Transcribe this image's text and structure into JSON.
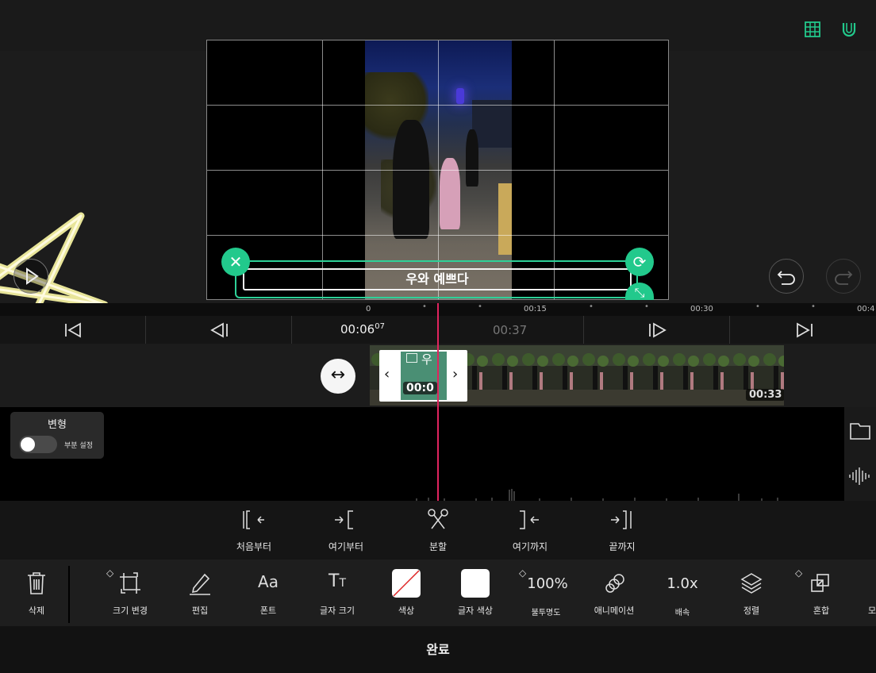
{
  "preview": {
    "subtitle": "우와 예쁘다"
  },
  "ruler": {
    "ticks": [
      "0",
      "00:15",
      "00:30",
      "00:4"
    ]
  },
  "transport": {
    "current_time": "00:06",
    "current_frames": "07",
    "total_time": "00:37"
  },
  "timeline": {
    "text_clip_glyph": "우",
    "text_clip_time": "00:0",
    "video_clip_duration": "00:33"
  },
  "transform_panel": {
    "title": "변형",
    "toggle_label": "부분 설정",
    "toggle_on": false
  },
  "edit_actions": [
    {
      "label": "처음부터",
      "icon": "trim-from-start-icon"
    },
    {
      "label": "여기부터",
      "icon": "trim-from-here-icon"
    },
    {
      "label": "분할",
      "icon": "split-scissors-icon"
    },
    {
      "label": "여기까지",
      "icon": "trim-to-here-icon"
    },
    {
      "label": "끝까지",
      "icon": "trim-to-end-icon"
    }
  ],
  "toolbar": {
    "delete": "삭제",
    "resize": "크기 변경",
    "edit": "편집",
    "font": "폰트",
    "font_size": "글자 크기",
    "color": "색상",
    "text_color": "글자 색상",
    "opacity_value": "100%",
    "opacity": "불투명도",
    "animation": "애니메이션",
    "speed_value": "1.0x",
    "speed": "배속",
    "arrange": "정렬",
    "blend": "혼합",
    "more_cut": "모"
  },
  "footer": {
    "done": "완료"
  },
  "colors": {
    "accent_green": "#22c98c",
    "playhead": "#e0245e",
    "star": "#f3f0a0"
  }
}
